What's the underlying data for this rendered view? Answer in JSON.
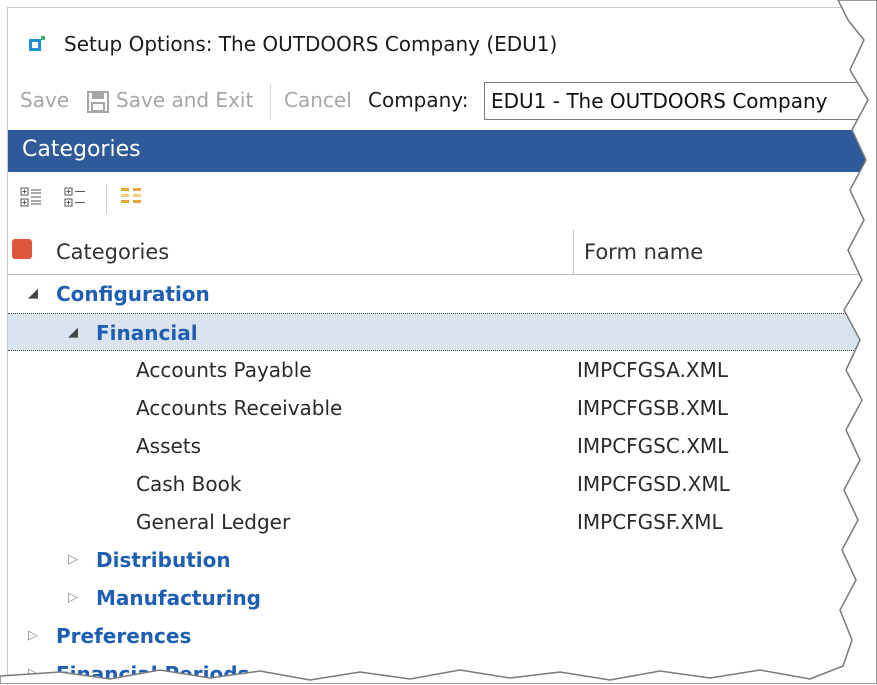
{
  "window": {
    "title": "Setup Options: The OUTDOORS Company (EDU1)",
    "app_icon": "setup-options-icon"
  },
  "toolbar": {
    "save_label": "Save",
    "save_exit_label": "Save and Exit",
    "cancel_label": "Cancel",
    "company_label": "Company:",
    "company_value": "EDU1 - The OUTDOORS Company"
  },
  "panel": {
    "header": "Categories",
    "tools": [
      "expand-all-icon",
      "collapse-all-icon",
      "group-icon"
    ]
  },
  "grid": {
    "columns": {
      "categories": "Categories",
      "form_name": "Form name"
    },
    "rows": [
      {
        "label": "Configuration",
        "level": 0,
        "state": "expanded",
        "form": ""
      },
      {
        "label": "Financial",
        "level": 1,
        "state": "expanded",
        "form": "",
        "selected": true
      },
      {
        "label": "Accounts Payable",
        "level": 2,
        "state": "leaf",
        "form": "IMPCFGSA.XML"
      },
      {
        "label": "Accounts Receivable",
        "level": 2,
        "state": "leaf",
        "form": "IMPCFGSB.XML"
      },
      {
        "label": "Assets",
        "level": 2,
        "state": "leaf",
        "form": "IMPCFGSC.XML"
      },
      {
        "label": "Cash Book",
        "level": 2,
        "state": "leaf",
        "form": "IMPCFGSD.XML"
      },
      {
        "label": "General Ledger",
        "level": 2,
        "state": "leaf",
        "form": "IMPCFGSF.XML"
      },
      {
        "label": "Distribution",
        "level": 1,
        "state": "collapsed",
        "form": ""
      },
      {
        "label": "Manufacturing",
        "level": 1,
        "state": "collapsed",
        "form": ""
      },
      {
        "label": "Preferences",
        "level": 0,
        "state": "collapsed",
        "form": ""
      },
      {
        "label": "Financial Periods",
        "level": 0,
        "state": "collapsed",
        "form": ""
      }
    ]
  },
  "colors": {
    "header_bg": "#2e5a9a",
    "node_text": "#1f5fb3",
    "selected_row": "#dbe3ef",
    "marker": "#e0563a"
  }
}
